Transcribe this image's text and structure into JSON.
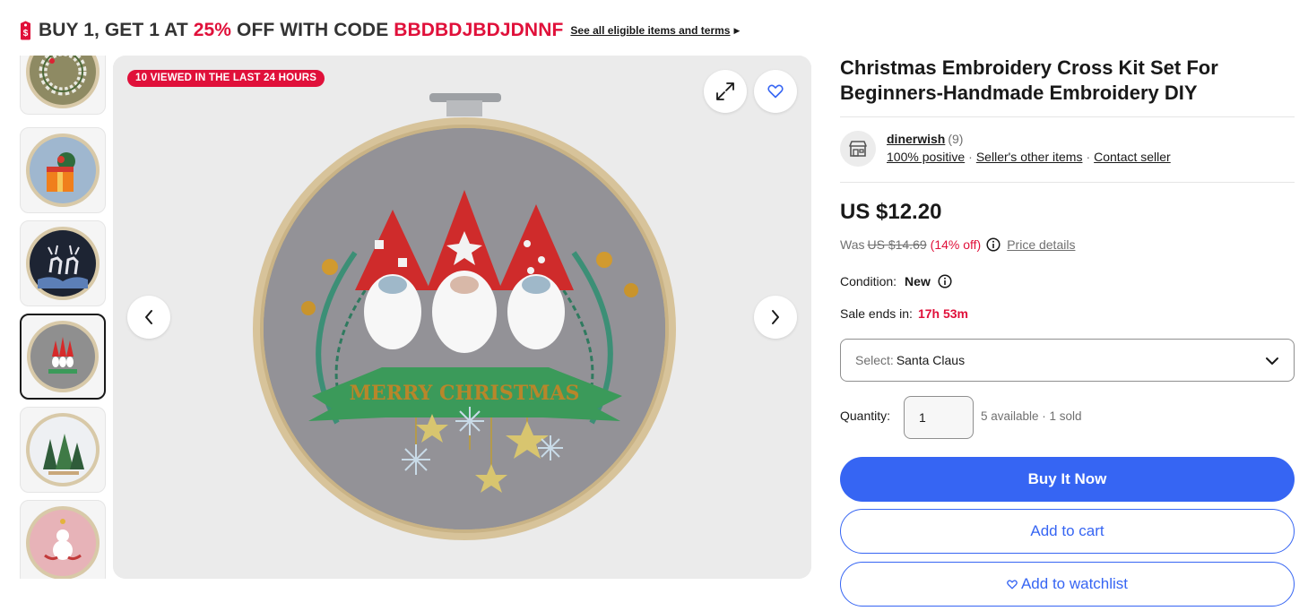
{
  "promo": {
    "prefix": "BUY 1, GET 1 AT ",
    "percent": "25%",
    "middle": " OFF WITH CODE ",
    "code": "BBDBDJBDJDNNF",
    "link": "See all eligible items and terms",
    "tag_icon": "price-tag-icon",
    "accent_color": "#e0103a"
  },
  "gallery": {
    "thumbnails": [
      {
        "icon": "wreath-embroidery-thumb"
      },
      {
        "icon": "gift-box-embroidery-thumb"
      },
      {
        "icon": "reindeer-embroidery-thumb"
      },
      {
        "icon": "gnomes-embroidery-thumb",
        "selected": true
      },
      {
        "icon": "trees-embroidery-thumb"
      },
      {
        "icon": "snowman-embroidery-thumb"
      }
    ],
    "badge": "10 VIEWED IN THE LAST 24 HOURS",
    "main_image_text": "MERRY CHRISTMAS"
  },
  "product": {
    "title": "Christmas Embroidery Cross Kit Set For Beginners-Handmade Embroidery DIY",
    "seller": {
      "name": "dinerwish",
      "count": "(9)",
      "positive": "100% positive",
      "other_items": "Seller's other items",
      "contact": "Contact seller"
    },
    "price": "US $12.20",
    "was_label": "Was",
    "was_price": "US $14.69",
    "discount": "(14% off)",
    "price_details": "Price details",
    "condition_label": "Condition:",
    "condition_value": "New",
    "sale_label": "Sale ends in:",
    "sale_value": "17h 53m",
    "select_label": "Select:",
    "select_value": "Santa Claus",
    "quantity_label": "Quantity:",
    "quantity_value": "1",
    "availability": "5 available · 1 sold",
    "buy_now": "Buy It Now",
    "add_to_cart": "Add to cart",
    "add_to_watchlist": "Add to watchlist",
    "primary_color": "#3665f3"
  }
}
